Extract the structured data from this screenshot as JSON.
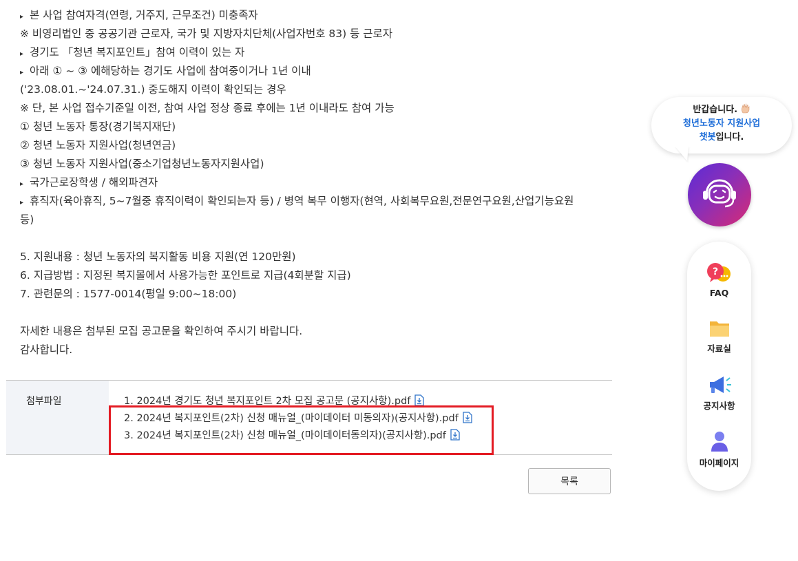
{
  "body": {
    "lines": [
      {
        "bullet": "▸",
        "text": "본 사업 참여자격(연령, 거주지, 근무조건) 미충족자"
      },
      {
        "bullet": "",
        "text": "※ 비영리법인 중 공공기관 근로자, 국가 및 지방자치단체(사업자번호 83) 등 근로자"
      },
      {
        "bullet": "▸",
        "text": "경기도 「청년 복지포인트」참여 이력이 있는 자"
      },
      {
        "bullet": "▸",
        "text": "아래 ① ~ ③ 에해당하는 경기도 사업에 참여중이거나 1년 이내"
      },
      {
        "bullet": "",
        "text": "('23.08.01.~'24.07.31.) 중도해지 이력이 확인되는 경우"
      },
      {
        "bullet": "",
        "text": "※ 단, 본 사업 접수기준일 이전, 참여 사업 정상 종료 후에는 1년 이내라도 참여 가능"
      },
      {
        "bullet": "",
        "text": "① 청년 노동자 통장(경기복지재단)"
      },
      {
        "bullet": "",
        "text": "② 청년 노동자 지원사업(청년연금)"
      },
      {
        "bullet": "",
        "text": "③ 청년 노동자 지원사업(중소기업청년노동자지원사업)"
      },
      {
        "bullet": "▸",
        "text": "국가근로장학생 / 해외파견자"
      },
      {
        "bullet": "▸",
        "text": "휴직자(육아휴직, 5~7월중 휴직이력이 확인되는자 등) / 병역 복무 이행자(현역, 사회복무요원,전문연구요원,산업기능요원"
      },
      {
        "bullet": "",
        "text": "등)"
      },
      {
        "bullet": "",
        "text": ""
      },
      {
        "bullet": "",
        "text": "5. 지원내용 : 청년 노동자의 복지활동 비용 지원(연 120만원)"
      },
      {
        "bullet": "",
        "text": "6. 지급방법 : 지정된 복지몰에서 사용가능한 포인트로 지급(4회분할 지급)"
      },
      {
        "bullet": "",
        "text": "7. 관련문의 : 1577-0014(평일 9:00~18:00)"
      },
      {
        "bullet": "",
        "text": ""
      },
      {
        "bullet": "",
        "text": "자세한 내용은 첨부된 모집 공고문을 확인하여 주시기 바랍니다."
      },
      {
        "bullet": "",
        "text": "감사합니다."
      }
    ]
  },
  "attachments": {
    "label": "첨부파일",
    "files": [
      {
        "name": "1. 2024년 경기도 청년 복지포인트 2차 모집 공고문 (공지사항).pdf",
        "icon": "download-icon"
      },
      {
        "name": "2. 2024년 복지포인트(2차) 신청 매뉴얼_(마이데이터 미동의자)(공지사항).pdf",
        "icon": "download-icon"
      },
      {
        "name": "3. 2024년 복지포인트(2차) 신청 매뉴얼_(마이데이터동의자)(공지사항).pdf",
        "icon": "download-icon"
      }
    ],
    "highlight_color": "#e31b23"
  },
  "list_button": "목록",
  "chatbot": {
    "greeting": "반갑습니다.",
    "greeting_icon": "waving-hand-icon",
    "service": "청년노동자 지원사업",
    "bot_name": "챗봇",
    "bot_suffix": "입니다.",
    "accent": "#1f6ed8"
  },
  "quick_menu": [
    {
      "label": "FAQ",
      "icon": "faq-icon"
    },
    {
      "label": "자료실",
      "icon": "folder-icon"
    },
    {
      "label": "공지사항",
      "icon": "megaphone-icon"
    },
    {
      "label": "마이페이지",
      "icon": "user-icon"
    }
  ]
}
